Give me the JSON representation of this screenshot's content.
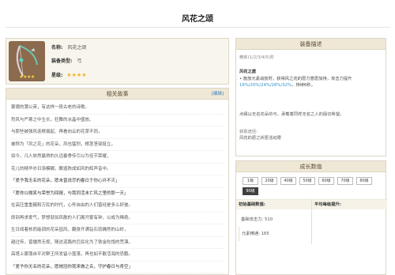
{
  "page": {
    "title": "风花之颂"
  },
  "item": {
    "name_label": "名称:",
    "name": "风花之颂",
    "type_label": "装备类型:",
    "type": "弓",
    "stars_label": "星级:",
    "stars": "★★★★",
    "rarity": 4
  },
  "story": {
    "header": "相关故事",
    "edit": "[编辑]",
    "lines": [
      "蒙德的蒲公英，有这样一段古老的诗歌。",
      "烈风与严寒之中生长，狂舞的冰晶中盛放。",
      "与那些被强风连根拔起、再看向云的花草不同，",
      "被称为「风之花」的花朵，风也猛烈，根茎坚韧挺立。",
      "如今，凡人依然赢得的久远春季传引以为佳节荣耀，",
      "花儿的精华亦日渐模糊，酿造陈成如风的辉声音中。",
      "「爱予我无名的花朵，愿未曾说尽的春日于你心许不灭」",
      "「愿你以微笑与荣誉为回报，与我同活未亡风之里的那一天」",
      "在高压重重巍和万民的时代，心怀自由的人们曾经是多么好彼。",
      "即刻再求爱气，梦想就如风散的人们离开繁有钟，以成为稀奇。",
      "生日闻着核而能调的花朵因风，翻身开满钻石就确然的山岭，",
      "越过传，曾播然无视，随这道路的巨民化为了铁金吃饱的荒漠。",
      "高塔上骤落自平对群王所发留小篮落，再也如不散活海的恐鹏。",
      "「爱予你无名的花朵，愿她冠你我来做之名，守护春日与青空」"
    ]
  },
  "description": {
    "header": "装备描述",
    "refine": "精炼(1/2/3/4/5)阶",
    "skill_name": "风花之愿",
    "effect_prefix": "• 施放元素战技时，获得风之花的愿力意愿加持，攻击力提升",
    "effect_values": "16%/20%/24%/28%/32%",
    "effect_suffix": "，持续6秒。",
    "lore": "点缀以无名花朵的弓，承载着同样无名之人的殷切希望。",
    "source_label": "获取途径:",
    "source": "风花的愿之祈愿活动限"
  },
  "growth": {
    "header": "成长数值",
    "levels": [
      "1级",
      "20级",
      "40级",
      "50级",
      "60级",
      "70级",
      "80级",
      "90级"
    ],
    "active_level": "90级",
    "base_header": "初始基础数值:",
    "avg_header": "平均每级提升:",
    "atk_label": "基础攻击力: ",
    "atk_value": "510",
    "em_label": "元素精通: ",
    "em_value": "165"
  }
}
